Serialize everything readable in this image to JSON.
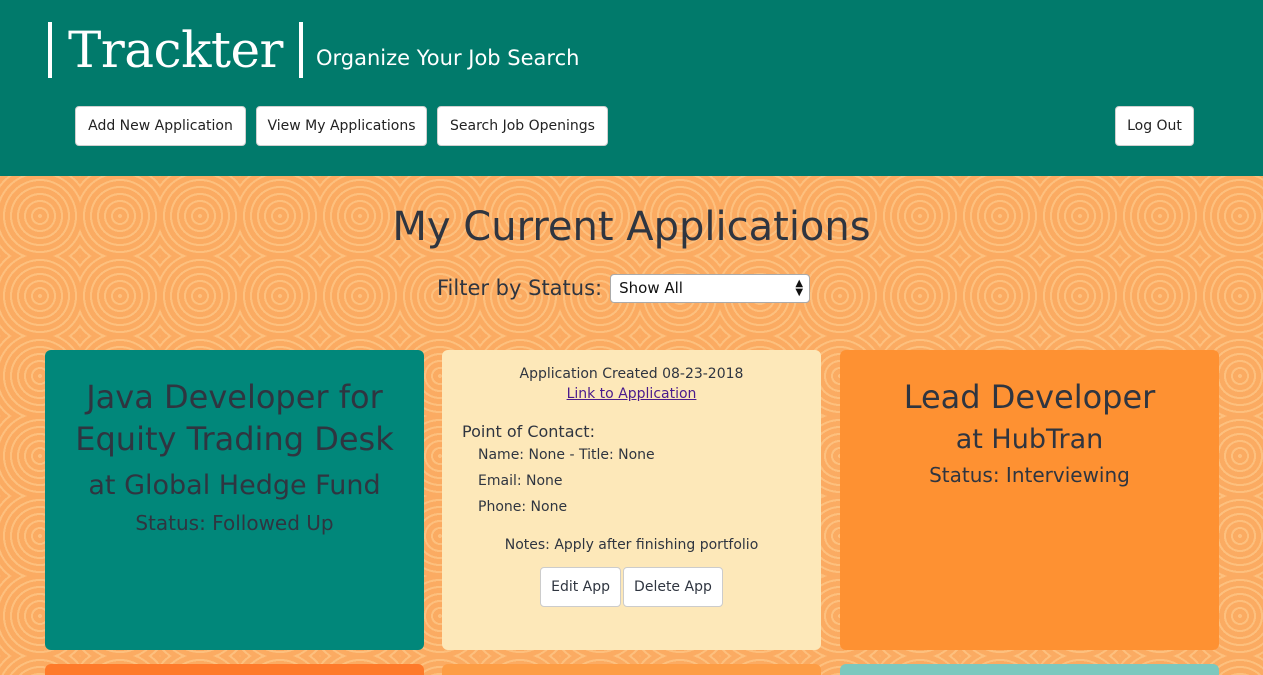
{
  "header": {
    "brand": "Trackter",
    "tagline": "Organize Your Job Search",
    "nav": {
      "add": "Add New Application",
      "view": "View My Applications",
      "search": "Search Job Openings",
      "logout": "Log Out"
    }
  },
  "main": {
    "title": "My Current Applications",
    "filter": {
      "label": "Filter by Status:",
      "selected": "Show All"
    }
  },
  "cards": [
    {
      "title": "Java Developer for Equity Trading Desk",
      "company": "at Global Hedge Fund",
      "status": "Status: Followed Up"
    },
    {
      "created": "Application Created 08-23-2018",
      "link": "Link to Application",
      "poc_heading": "Point of Contact:",
      "poc_name": "Name: None - Title: None",
      "poc_email": "Email: None",
      "poc_phone": "Phone: None",
      "notes": "Notes: Apply after finishing portfolio",
      "edit": "Edit App",
      "delete": "Delete App"
    },
    {
      "title": "Lead Developer",
      "company": "at HubTran",
      "status": "Status: Interviewing"
    }
  ],
  "colors": {
    "header": "#017a6b",
    "card_teal": "#01877a",
    "card_cream": "#fde8b9",
    "card_orange": "#fe9132",
    "background": "#fbab62",
    "peek_light_teal": "#7cc8be"
  }
}
